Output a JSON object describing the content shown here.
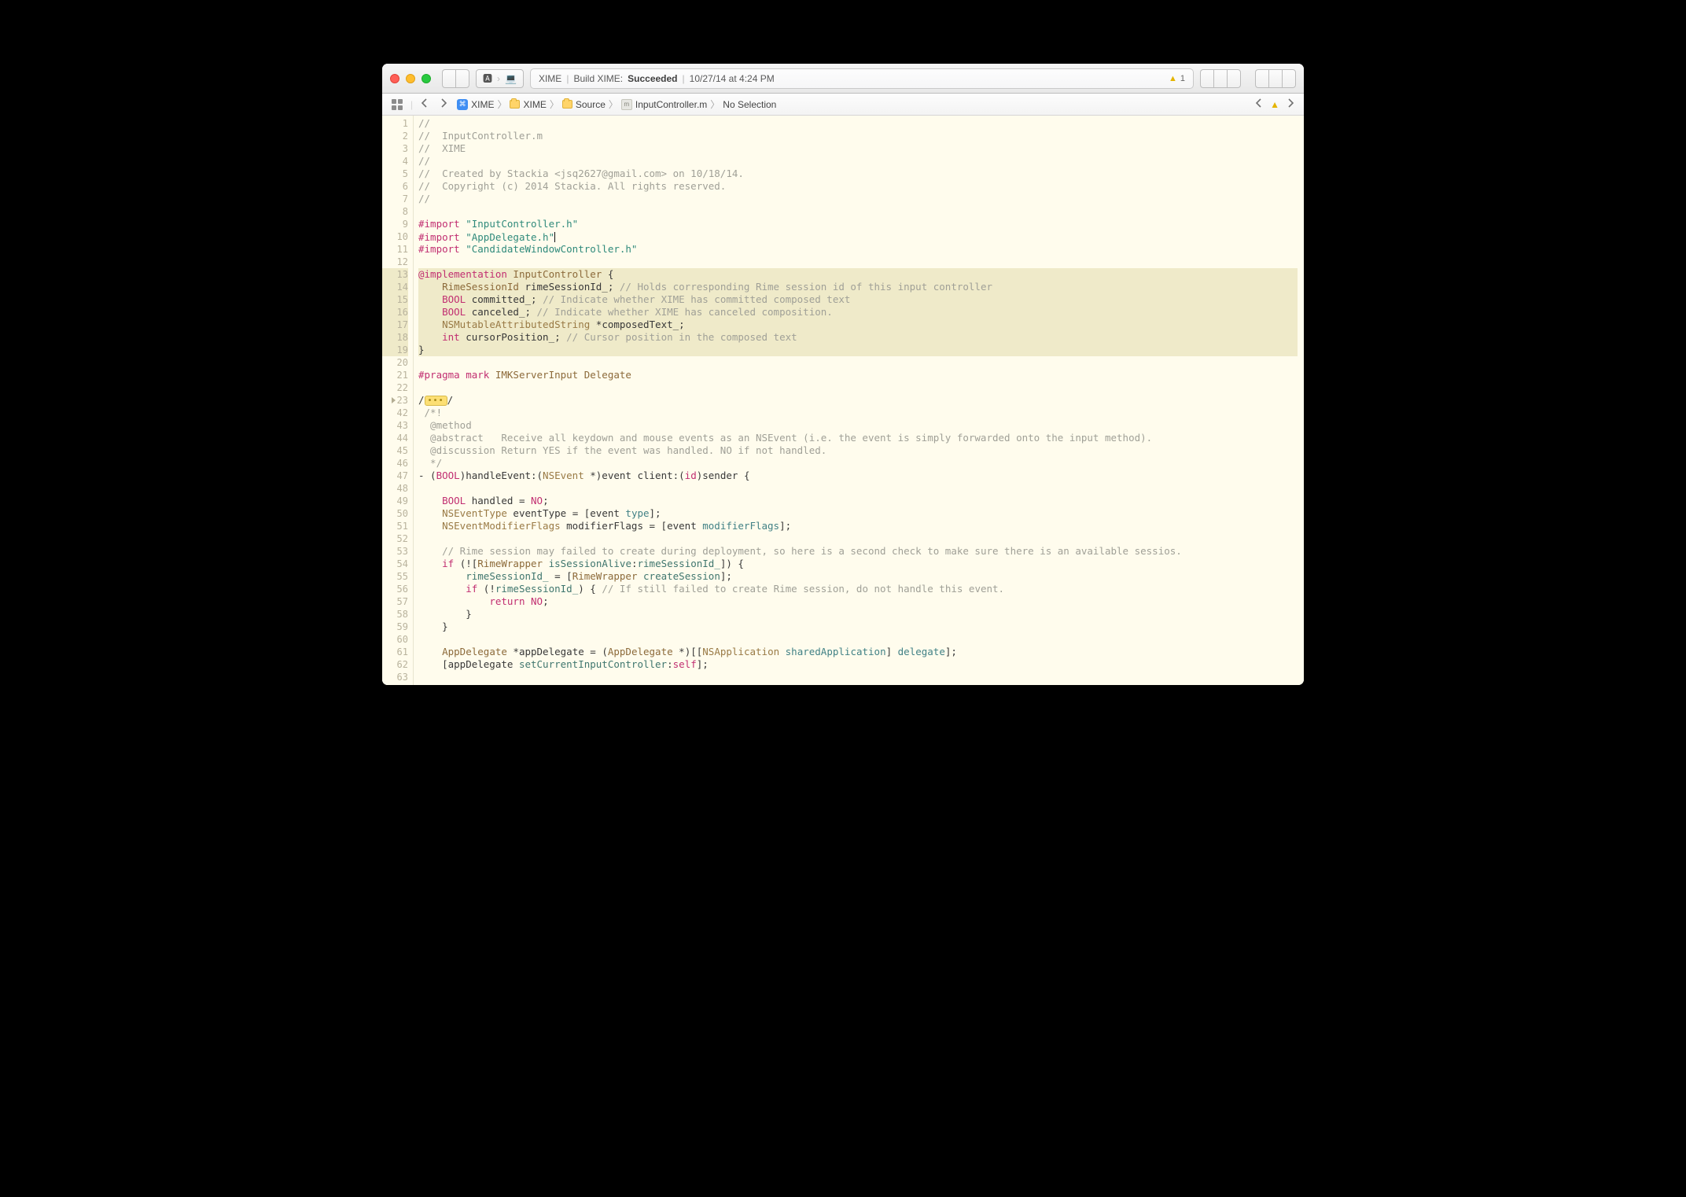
{
  "toolbar": {
    "scheme_left": "▣",
    "scheme_right": "⌨",
    "status": {
      "project": "XIME",
      "action_prefix": "Build XIME:",
      "result": "Succeeded",
      "time": "10/27/14 at 4:24 PM"
    },
    "warning_count": "1"
  },
  "jumpbar": {
    "items": [
      {
        "label": "XIME",
        "icon": "project"
      },
      {
        "label": "XIME",
        "icon": "folder"
      },
      {
        "label": "Source",
        "icon": "folder"
      },
      {
        "label": "InputController.m",
        "icon": "mfile"
      },
      {
        "label": "No Selection",
        "icon": ""
      }
    ]
  },
  "code": {
    "line_numbers": [
      "1",
      "2",
      "3",
      "4",
      "5",
      "6",
      "7",
      "8",
      "9",
      "10",
      "11",
      "12",
      "13",
      "14",
      "15",
      "16",
      "17",
      "18",
      "19",
      "20",
      "21",
      "22",
      "23",
      "42",
      "43",
      "44",
      "45",
      "46",
      "47",
      "48",
      "49",
      "50",
      "51",
      "52",
      "53",
      "54",
      "55",
      "56",
      "57",
      "58",
      "59",
      "60",
      "61",
      "62",
      "63"
    ],
    "highlight": [
      13,
      14,
      15,
      16,
      17,
      18,
      19
    ],
    "fold_at_index": 22,
    "raw": [
      [
        [
          "comment",
          "//"
        ]
      ],
      [
        [
          "comment",
          "//  InputController.m"
        ]
      ],
      [
        [
          "comment",
          "//  XIME"
        ]
      ],
      [
        [
          "comment",
          "//"
        ]
      ],
      [
        [
          "comment",
          "//  Created by Stackia <jsq2627@gmail.com> on 10/18/14."
        ]
      ],
      [
        [
          "comment",
          "//  Copyright (c) 2014 Stackia. All rights reserved."
        ]
      ],
      [
        [
          "comment",
          "//"
        ]
      ],
      [],
      [
        [
          "keyword",
          "#import "
        ],
        [
          "string",
          "\"InputController.h\""
        ]
      ],
      [
        [
          "keyword",
          "#import "
        ],
        [
          "string",
          "\"AppDelegate.h\""
        ],
        [
          "cursor",
          ""
        ]
      ],
      [
        [
          "keyword",
          "#import "
        ],
        [
          "string",
          "\"CandidateWindowController.h\""
        ]
      ],
      [],
      [
        [
          "keyword",
          "@implementation"
        ],
        [
          "plain",
          " "
        ],
        [
          "brown",
          "InputController"
        ],
        [
          "plain",
          " {"
        ]
      ],
      [
        [
          "plain",
          "    "
        ],
        [
          "brown",
          "RimeSessionId"
        ],
        [
          "plain",
          " rimeSessionId_; "
        ],
        [
          "comment",
          "// Holds corresponding Rime session id of this input controller"
        ]
      ],
      [
        [
          "plain",
          "    "
        ],
        [
          "keyword",
          "BOOL"
        ],
        [
          "plain",
          " committed_; "
        ],
        [
          "comment",
          "// Indicate whether XIME has committed composed text"
        ]
      ],
      [
        [
          "plain",
          "    "
        ],
        [
          "keyword",
          "BOOL"
        ],
        [
          "plain",
          " canceled_; "
        ],
        [
          "comment",
          "// Indicate whether XIME has canceled composition."
        ]
      ],
      [
        [
          "plain",
          "    "
        ],
        [
          "type",
          "NSMutableAttributedString"
        ],
        [
          "plain",
          " *composedText_;"
        ]
      ],
      [
        [
          "plain",
          "    "
        ],
        [
          "keyword",
          "int"
        ],
        [
          "plain",
          " cursorPosition_; "
        ],
        [
          "comment",
          "// Cursor position in the composed text"
        ]
      ],
      [
        [
          "plain",
          "}"
        ]
      ],
      [],
      [
        [
          "keyword",
          "#pragma mark "
        ],
        [
          "brown",
          "IMKServerInput Delegate"
        ]
      ],
      [],
      [
        [
          "plain",
          "/"
        ],
        [
          "fold",
          "•••"
        ],
        [
          "plain",
          "/"
        ]
      ],
      [
        [
          "comment",
          " /*!"
        ]
      ],
      [
        [
          "comment",
          "  @method"
        ]
      ],
      [
        [
          "comment",
          "  @abstract   "
        ],
        [
          "comment2",
          "Receive all keydown and mouse events as an NSEvent (i.e. the event is simply forwarded onto the input method)."
        ]
      ],
      [
        [
          "comment",
          "  @discussion "
        ],
        [
          "comment2",
          "Return YES if the event was handled. NO if not handled."
        ]
      ],
      [
        [
          "comment",
          "  */"
        ]
      ],
      [
        [
          "plain",
          "- ("
        ],
        [
          "keyword",
          "BOOL"
        ],
        [
          "plain",
          ")handleEvent:("
        ],
        [
          "type",
          "NSEvent"
        ],
        [
          "plain",
          " *)event client:("
        ],
        [
          "keyword",
          "id"
        ],
        [
          "plain",
          ")sender {"
        ]
      ],
      [],
      [
        [
          "plain",
          "    "
        ],
        [
          "keyword",
          "BOOL"
        ],
        [
          "plain",
          " handled = "
        ],
        [
          "keyword",
          "NO"
        ],
        [
          "plain",
          ";"
        ]
      ],
      [
        [
          "plain",
          "    "
        ],
        [
          "type",
          "NSEventType"
        ],
        [
          "plain",
          " eventType = [event "
        ],
        [
          "method",
          "type"
        ],
        [
          "plain",
          "];"
        ]
      ],
      [
        [
          "plain",
          "    "
        ],
        [
          "type",
          "NSEventModifierFlags"
        ],
        [
          "plain",
          " modifierFlags = [event "
        ],
        [
          "method",
          "modifierFlags"
        ],
        [
          "plain",
          "];"
        ]
      ],
      [],
      [
        [
          "plain",
          "    "
        ],
        [
          "comment",
          "// Rime session may failed to create during deployment, so here is a second check to make sure there is an available sessios."
        ]
      ],
      [
        [
          "plain",
          "    "
        ],
        [
          "keyword",
          "if"
        ],
        [
          "plain",
          " (!["
        ],
        [
          "brown",
          "RimeWrapper"
        ],
        [
          "plain",
          " "
        ],
        [
          "ident",
          "isSessionAlive"
        ],
        [
          "plain",
          ":"
        ],
        [
          "ident",
          "rimeSessionId_"
        ],
        [
          "plain",
          "]) {"
        ]
      ],
      [
        [
          "plain",
          "        "
        ],
        [
          "ident",
          "rimeSessionId_"
        ],
        [
          "plain",
          " = ["
        ],
        [
          "brown",
          "RimeWrapper"
        ],
        [
          "plain",
          " "
        ],
        [
          "ident",
          "createSession"
        ],
        [
          "plain",
          "];"
        ]
      ],
      [
        [
          "plain",
          "        "
        ],
        [
          "keyword",
          "if"
        ],
        [
          "plain",
          " (!"
        ],
        [
          "ident",
          "rimeSessionId_"
        ],
        [
          "plain",
          ") { "
        ],
        [
          "comment",
          "// If still failed to create Rime session, do not handle this event."
        ]
      ],
      [
        [
          "plain",
          "            "
        ],
        [
          "keyword",
          "return"
        ],
        [
          "plain",
          " "
        ],
        [
          "keyword",
          "NO"
        ],
        [
          "plain",
          ";"
        ]
      ],
      [
        [
          "plain",
          "        }"
        ]
      ],
      [
        [
          "plain",
          "    }"
        ]
      ],
      [],
      [
        [
          "plain",
          "    "
        ],
        [
          "brown",
          "AppDelegate"
        ],
        [
          "plain",
          " *appDelegate = ("
        ],
        [
          "brown",
          "AppDelegate"
        ],
        [
          "plain",
          " *)[["
        ],
        [
          "type",
          "NSApplication"
        ],
        [
          "plain",
          " "
        ],
        [
          "method",
          "sharedApplication"
        ],
        [
          "plain",
          "] "
        ],
        [
          "method",
          "delegate"
        ],
        [
          "plain",
          "];"
        ]
      ],
      [
        [
          "plain",
          "    [appDelegate "
        ],
        [
          "ident",
          "setCurrentInputController"
        ],
        [
          "plain",
          ":"
        ],
        [
          "keyword",
          "self"
        ],
        [
          "plain",
          "];"
        ]
      ],
      []
    ]
  }
}
